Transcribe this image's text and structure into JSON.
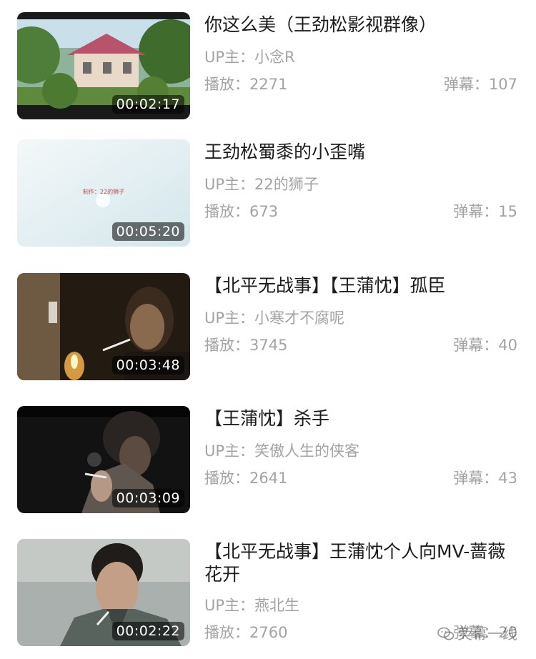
{
  "videos": [
    {
      "title": "你这么美（王劲松影视群像）",
      "uploader_label": "UP主：",
      "uploader": "小念R",
      "plays_label": "播放：",
      "plays": "2271",
      "danmaku_label": "弹幕：",
      "danmaku": "107",
      "duration": "00:02:17"
    },
    {
      "title": "王劲松蜀黍的小歪嘴",
      "uploader_label": "UP主：",
      "uploader": "22的狮子",
      "plays_label": "播放：",
      "plays": "673",
      "danmaku_label": "弹幕：",
      "danmaku": "15",
      "duration": "00:05:20",
      "thumb_caption": "制作：22的狮子"
    },
    {
      "title": "【北平无战事】【王蒲忱】孤臣",
      "uploader_label": "UP主：",
      "uploader": "小寒才不腐呢",
      "plays_label": "播放：",
      "plays": "3745",
      "danmaku_label": "弹幕：",
      "danmaku": "40",
      "duration": "00:03:48"
    },
    {
      "title": "【王蒲忱】杀手",
      "uploader_label": "UP主：",
      "uploader": "笑傲人生的侠客",
      "plays_label": "播放：",
      "plays": "2641",
      "danmaku_label": "弹幕：",
      "danmaku": "43",
      "duration": "00:03:09"
    },
    {
      "title": "【北平无战事】王蒲忱个人向MV-蔷薇花开",
      "uploader_label": "UP主：",
      "uploader": "燕北生",
      "plays_label": "播放：",
      "plays": "2760",
      "danmaku_label": "弹幕：",
      "danmaku": "20",
      "duration": "00:02:22"
    }
  ],
  "watermark": {
    "text": "荧幕一线",
    "icon": "wechat-icon"
  }
}
